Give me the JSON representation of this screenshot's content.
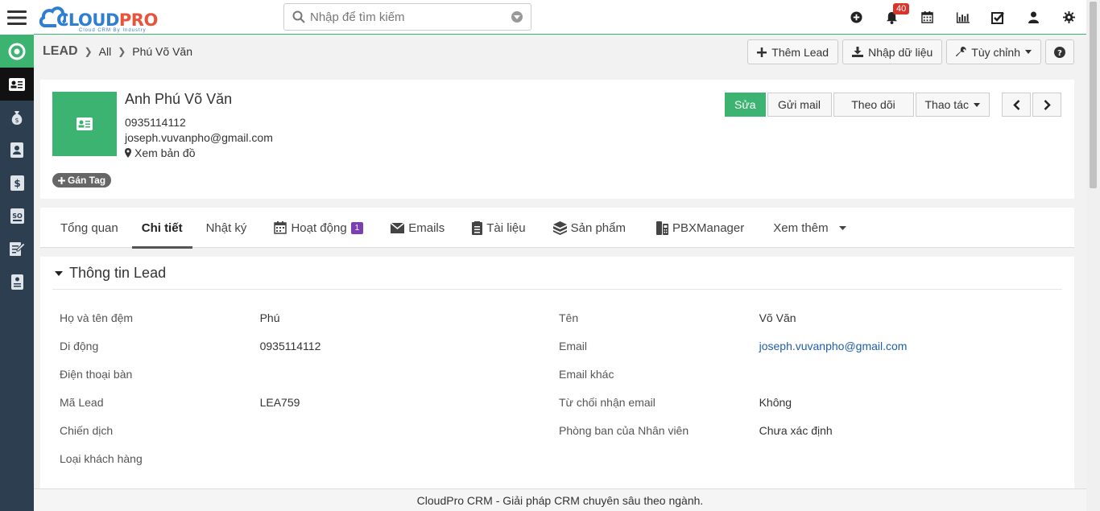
{
  "topbar": {
    "logo_main_1": "CLOUD",
    "logo_main_2": "PRO",
    "logo_sub": "Cloud CRM By Industry",
    "search_placeholder": "Nhập để tìm kiếm",
    "notification_count": "40"
  },
  "breadcrumb": {
    "module": "LEAD",
    "filter": "All",
    "record": "Phú Võ Văn"
  },
  "header_buttons": {
    "add": "Thêm Lead",
    "import": "Nhập dữ liệu",
    "customize": "Tùy chỉnh"
  },
  "record": {
    "name": "Anh Phú Võ Văn",
    "phone": "0935114112",
    "email": "joseph.vuvanpho@gmail.com",
    "map_link": "Xem bản đồ",
    "tag_button": "Gán Tag",
    "actions": {
      "edit": "Sửa",
      "send_mail": "Gửi mail",
      "follow": "Theo dõi",
      "more": "Thao tác"
    }
  },
  "tabs": [
    {
      "label": "Tổng quan",
      "icon": ""
    },
    {
      "label": "Chi tiết",
      "icon": ""
    },
    {
      "label": "Nhật ký",
      "icon": ""
    },
    {
      "label": "Hoạt động",
      "icon": "calendar-icon",
      "count": "1"
    },
    {
      "label": "Emails",
      "icon": "envelope-icon"
    },
    {
      "label": "Tài liệu",
      "icon": "document-icon"
    },
    {
      "label": "Sản phẩm",
      "icon": "cube-icon"
    },
    {
      "label": "PBXManager",
      "icon": "phone-icon"
    },
    {
      "label": "Xem thêm",
      "icon": "caret-down-icon"
    }
  ],
  "section": {
    "title": "Thông tin Lead",
    "rows": [
      {
        "l1": "Họ và tên đệm",
        "v1": "Phú",
        "l2": "Tên",
        "v2": "Võ Văn"
      },
      {
        "l1": "Di động",
        "v1": "0935114112",
        "l2": "Email",
        "v2": "joseph.vuvanpho@gmail.com"
      },
      {
        "l1": "Điện thoại bàn",
        "v1": "",
        "l2": "Email khác",
        "v2": ""
      },
      {
        "l1": "Mã Lead",
        "v1": "LEA759",
        "l2": "Từ chối nhận email",
        "v2": "Không"
      },
      {
        "l1": "Chiến dịch",
        "v1": "",
        "l2": "Phòng ban của Nhân viên",
        "v2": "Chưa xác định"
      },
      {
        "l1": "Loại khách hàng",
        "v1": "",
        "l2": "",
        "v2": ""
      }
    ]
  },
  "footer": "CloudPro CRM - Giải pháp CRM chuyên sâu theo ngành.",
  "colors": {
    "accent": "#3cb371",
    "sidebar": "#2c3e50",
    "link": "#1f5eab",
    "badge": "#d9342b",
    "count_badge": "#7b3fb4"
  }
}
